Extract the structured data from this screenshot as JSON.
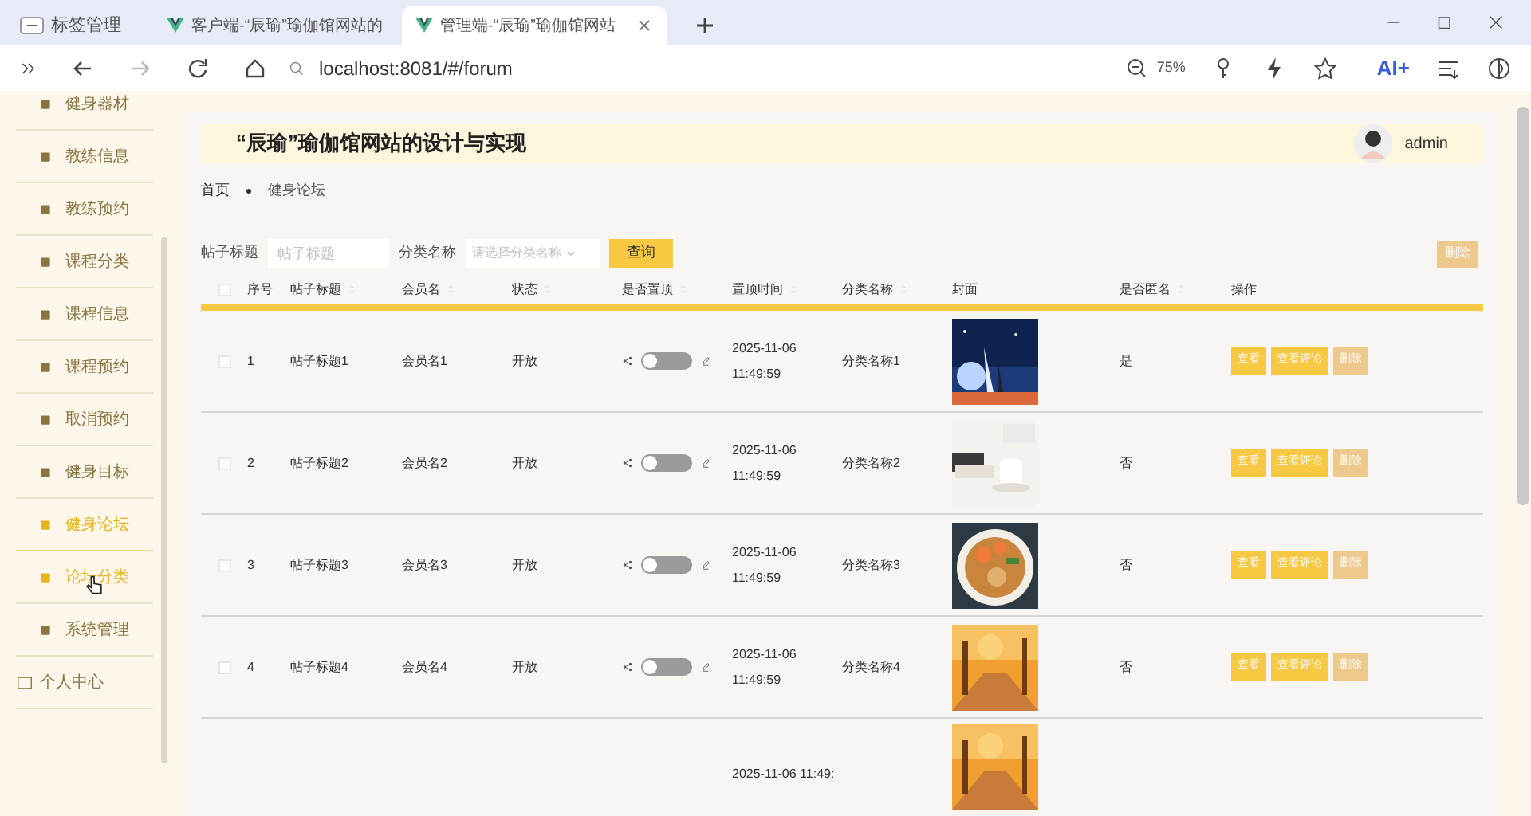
{
  "browser": {
    "tabs": [
      {
        "label": "标签管理",
        "kind": "group",
        "selected": false
      },
      {
        "label": "客户端-“辰瑜”瑜伽馆网站的",
        "kind": "page",
        "selected": false
      },
      {
        "label": "管理端-“辰瑜”瑜伽馆网站",
        "kind": "page",
        "selected": true
      }
    ],
    "url": "localhost:8081/#/forum",
    "zoom": "75%",
    "ai_label": "AI+"
  },
  "sidebar": {
    "items": [
      {
        "label": "健身器材",
        "selected": false
      },
      {
        "label": "教练信息",
        "selected": false
      },
      {
        "label": "教练预约",
        "selected": false
      },
      {
        "label": "课程分类",
        "selected": false
      },
      {
        "label": "课程信息",
        "selected": false
      },
      {
        "label": "课程预约",
        "selected": false
      },
      {
        "label": "取消预约",
        "selected": false
      },
      {
        "label": "健身目标",
        "selected": false
      },
      {
        "label": "健身论坛",
        "selected": true
      },
      {
        "label": "论坛分类",
        "selected": false,
        "hovered": true
      },
      {
        "label": "系统管理",
        "selected": false
      }
    ],
    "personal": "个人中心"
  },
  "header": {
    "title": "“辰瑜”瑜伽馆网站的设计与实现",
    "user": "admin"
  },
  "breadcrumb": [
    "首页",
    "健身论坛"
  ],
  "search": {
    "title_label": "帖子标题",
    "title_placeholder": "帖子标题",
    "category_label": "分类名称",
    "category_placeholder": "请选择分类名称",
    "query_button": "查询",
    "delete_button": "删除"
  },
  "table": {
    "select_all_checked": false,
    "columns": [
      {
        "label": "序号",
        "sortable": false
      },
      {
        "label": "帖子标题",
        "sortable": true
      },
      {
        "label": "会员名",
        "sortable": true
      },
      {
        "label": "状态",
        "sortable": true
      },
      {
        "label": "是否置顶",
        "sortable": true
      },
      {
        "label": "置顶时间",
        "sortable": true
      },
      {
        "label": "分类名称",
        "sortable": true
      },
      {
        "label": "封面",
        "sortable": false
      },
      {
        "label": "是否匿名",
        "sortable": true
      },
      {
        "label": "操作",
        "sortable": false
      }
    ],
    "rows": [
      {
        "checked": false,
        "index": "1",
        "title": "帖子标题1",
        "member": "会员名1",
        "status": "开放",
        "pinned": false,
        "time": "2025-11-06 11:49:59",
        "category": "分类名称1",
        "cover": {
          "kind": "picture"
        },
        "anonymous": "是",
        "actions": [
          "查看",
          "查看评论",
          "删除"
        ]
      },
      {
        "checked": false,
        "index": "2",
        "title": "帖子标题2",
        "member": "会员名2",
        "status": "开放",
        "pinned": false,
        "time": "2025-11-06 11:49:59",
        "category": "分类名称2",
        "cover": {
          "kind": "picture"
        },
        "anonymous": "否",
        "actions": [
          "查看",
          "查看评论",
          "删除"
        ]
      },
      {
        "checked": false,
        "index": "3",
        "title": "帖子标题3",
        "member": "会员名3",
        "status": "开放",
        "pinned": false,
        "time": "2025-11-06 11:49:59",
        "category": "分类名称3",
        "cover": {
          "kind": "picture"
        },
        "anonymous": "否",
        "actions": [
          "查看",
          "查看评论",
          "删除"
        ]
      },
      {
        "checked": false,
        "index": "4",
        "title": "帖子标题4",
        "member": "会员名4",
        "status": "开放",
        "pinned": false,
        "time": "2025-11-06 11:49:59",
        "category": "分类名称4",
        "cover": {
          "kind": "picture"
        },
        "anonymous": "否",
        "actions": [
          "查看",
          "查看评论",
          "删除"
        ]
      }
    ],
    "partial_row": {
      "time": "2025-11-06 11:49:",
      "cover": {
        "kind": "picture"
      }
    }
  }
}
